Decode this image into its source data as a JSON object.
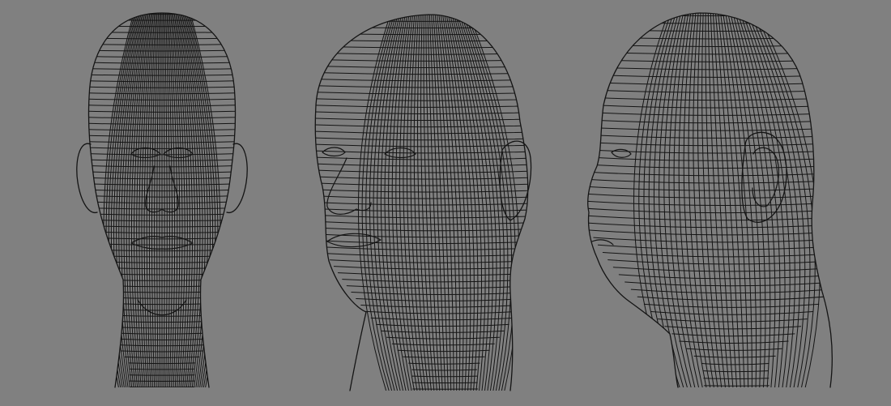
{
  "scene": {
    "background_color": "#808080",
    "wire_color": "#141414",
    "views": [
      {
        "view": "front"
      },
      {
        "view": "three-quarter"
      },
      {
        "view": "side"
      }
    ]
  }
}
